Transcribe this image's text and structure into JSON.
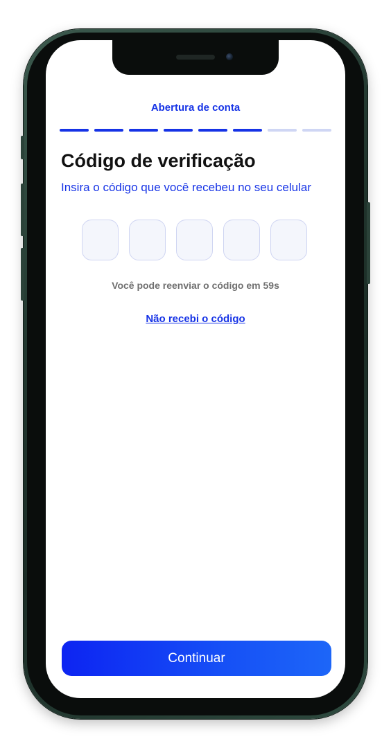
{
  "header": {
    "title": "Abertura  de conta"
  },
  "progress": {
    "total_steps": 8,
    "completed_steps": 6,
    "active_color": "#1633e6",
    "inactive_color": "#cfd6f4"
  },
  "main": {
    "title": "Código de verificação",
    "subtitle": "Insira o código que você recebeu no seu celular",
    "code_length": 5,
    "resend_info": "Você pode reenviar o código em 59s",
    "resend_link": "Não recebi o código"
  },
  "footer": {
    "continue_label": "Continuar"
  },
  "colors": {
    "accent": "#1633e6",
    "button_gradient_start": "#0d24f2",
    "button_gradient_end": "#1d66f8",
    "phone_frame": "#22372f"
  }
}
